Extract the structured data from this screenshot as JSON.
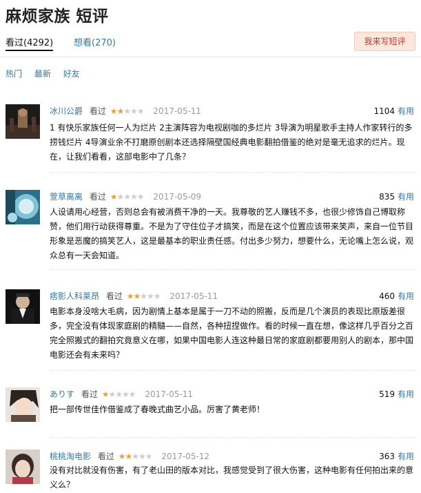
{
  "page": {
    "title": "麻烦家族 短评",
    "tabs": {
      "watched": "看过(4292)",
      "want": "想看(270)"
    },
    "write_button": "我来写短评",
    "sort": [
      "热门",
      "最新",
      "好友"
    ],
    "useful_label": "有用"
  },
  "reviews": [
    {
      "user": "冰川公爵",
      "label": "看过",
      "stars_filled": "★★",
      "stars_empty": "★★★",
      "rating": 2,
      "date": "2017-05-11",
      "votes": "1104",
      "content": "1 有快乐家族任何一人为烂片 2主演阵容为电视剧咖的多烂片 3导演为明星歌手主持人作家转行的多捞钱烂片 4导演业余不打磨原创剧本还选择隔壁国经典电影翻拍借鉴的绝对是毫无追求的烂片。现在，让我们看看，这部电影中了几条？"
    },
    {
      "user": "萱草离离",
      "label": "看过",
      "stars_filled": "★",
      "stars_empty": "★★★★",
      "rating": 1,
      "date": "2017-05-09",
      "votes": "835",
      "content": "人设请用心经营，否则总会有被消费干净的一天。我尊敬的艺人赚钱不多，也很少修饰自己博取称赞，他们用行动获得尊重。不是为了守住位子才搞笑，而是在这个位置应该带来笑声，来自一位节目形象是恶魔的搞笑艺人，这是最基本的职业责任感。付出多少努力，想要什么，无论嘴上怎么说，观众总有一天会知道。"
    },
    {
      "user": "痞影人科莱昂",
      "label": "看过",
      "stars_filled": "★★",
      "stars_empty": "★★★",
      "rating": 2,
      "date": "2017-05-11",
      "votes": "460",
      "content": "电影本身没啥大毛病，因为剧情上基本是属于一刀不动的照搬，反而是几个演员的表现比原版差很多，完全没有体现家庭剧的精髓——自然，各种扭捏做作。看的时候一直在想，像这样几乎百分之百完全照搬式的翻拍究竟意义在哪，如果中国电影人连这种最日常的家庭剧都要用别人的剧本，那中国电影还会有未来吗？"
    },
    {
      "user": "ありす",
      "label": "看过",
      "stars_filled": "★",
      "stars_empty": "★★★★",
      "rating": 1,
      "date": "2017-05-11",
      "votes": "519",
      "content": "把一部传世佳作借鉴成了春晚式曲艺小品。厉害了黄老师！"
    },
    {
      "user": "桃桃淘电影",
      "label": "看过",
      "stars_filled": "★★",
      "stars_empty": "★★★",
      "rating": 2,
      "date": "2017-05-12",
      "votes": "363",
      "content": "没有对比就没有伤害，有了老山田的版本对比，我感觉受到了很大伤害，这种电影有任何拍出来的意义么？"
    }
  ],
  "colors": {
    "link": "#3377aa",
    "star": "#e6a23c",
    "button_bg": "#fbe8dc",
    "button_text": "#c0392b"
  }
}
